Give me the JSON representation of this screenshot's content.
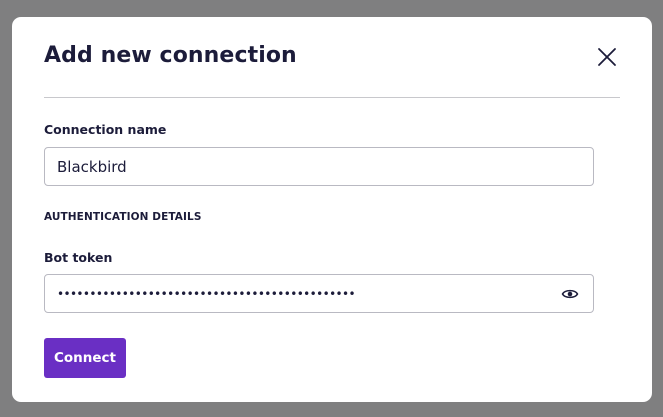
{
  "modal": {
    "title": "Add new connection"
  },
  "connection_name": {
    "label": "Connection name",
    "value": "Blackbird"
  },
  "auth_section": {
    "label": "AUTHENTICATION DETAILS"
  },
  "bot_token": {
    "label": "Bot token",
    "masked_value": "••••••••••••••••••••••••••••••••••••••••••••••",
    "toggle_icon": "eye-icon"
  },
  "actions": {
    "connect_label": "Connect"
  },
  "colors": {
    "accent": "#6a2fc4",
    "overlay": "#7f7f80",
    "text": "#1c1c3a"
  }
}
